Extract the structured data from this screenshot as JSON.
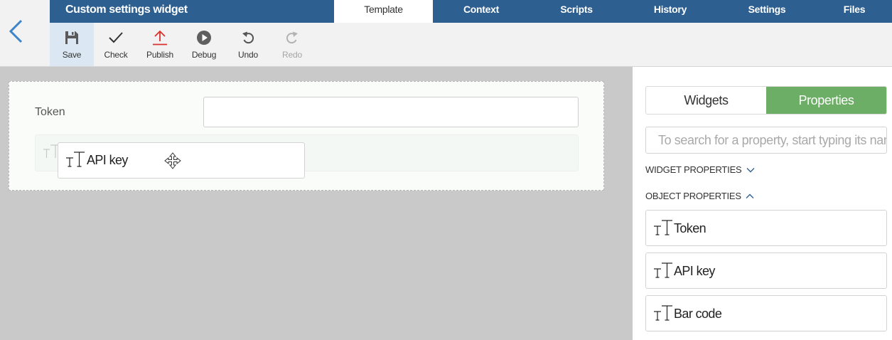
{
  "header": {
    "title": "Custom settings widget",
    "tabs": [
      {
        "label": "Template",
        "active": true
      },
      {
        "label": "Context",
        "active": false
      },
      {
        "label": "Scripts",
        "active": false
      },
      {
        "label": "History",
        "active": false
      },
      {
        "label": "Settings",
        "active": false
      },
      {
        "label": "Files",
        "active": false
      }
    ]
  },
  "toolbar": {
    "save": "Save",
    "check": "Check",
    "publish": "Publish",
    "debug": "Debug",
    "undo": "Undo",
    "redo": "Redo"
  },
  "canvas": {
    "token_label": "Token",
    "token_value": "",
    "dragged_item": "API key"
  },
  "panel": {
    "widgets_tab": "Widgets",
    "properties_tab": "Properties",
    "search_placeholder": "To search for a property, start typing its name",
    "widget_properties": "WIDGET PROPERTIES",
    "object_properties": "OBJECT PROPERTIES",
    "items": [
      "Token",
      "API key",
      "Bar code"
    ]
  },
  "colors": {
    "header": "#2d5f91",
    "accent_green": "#6cae65",
    "publish_red": "#d9312b",
    "back_arrow": "#3f83c9"
  }
}
